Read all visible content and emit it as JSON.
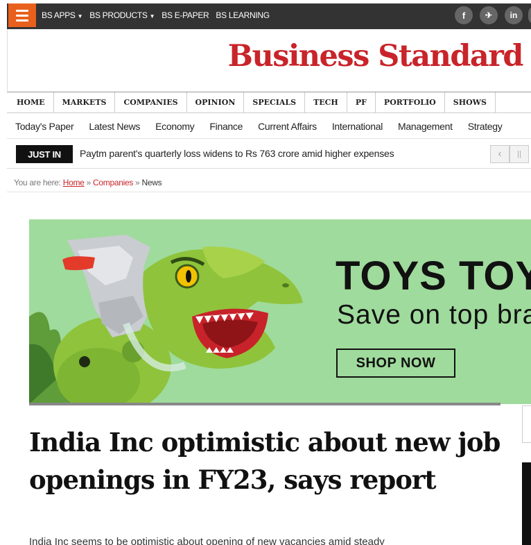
{
  "topbar": {
    "nav": [
      {
        "label": "BS APPS",
        "has_caret": true
      },
      {
        "label": "BS PRODUCTS",
        "has_caret": true
      },
      {
        "label": "BS E-PAPER",
        "has_caret": false
      },
      {
        "label": "BS LEARNING",
        "has_caret": false
      }
    ],
    "social_icons": [
      "facebook-icon",
      "telegram-icon",
      "linkedin-icon"
    ],
    "social_glyphs": {
      "facebook": "f",
      "telegram": "✈",
      "linkedin": "in"
    }
  },
  "masthead": {
    "logo": "Business Standard",
    "logo_color": "#c8242a"
  },
  "main_nav": [
    "HOME",
    "MARKETS",
    "COMPANIES",
    "OPINION",
    "SPECIALS",
    "TECH",
    "PF",
    "PORTFOLIO",
    "SHOWS"
  ],
  "sub_nav": [
    "Today's Paper",
    "Latest News",
    "Economy",
    "Finance",
    "Current Affairs",
    "International",
    "Management",
    "Strategy"
  ],
  "ticker": {
    "label": "JUST IN",
    "headline": "Paytm parent's quarterly loss widens to Rs 763 crore amid higher expenses",
    "prev_glyph": "‹",
    "pause_glyph": "||"
  },
  "breadcrumb": {
    "prefix": "You are here: ",
    "home": "Home",
    "sep1": " » ",
    "section": "Companies",
    "sep2": " » ",
    "current": "News"
  },
  "ad": {
    "title": "TOYS TOYS",
    "subtitle": "Save on top brands",
    "cta": "SHOP NOW",
    "background": "#9fdb9c"
  },
  "article": {
    "title": "India Inc optimistic about new job openings in FY23, says report",
    "summary": "India Inc seems to be optimistic about opening of new vacancies amid steady"
  },
  "colors": {
    "accent": "#e8601c",
    "brand": "#c8242a",
    "topbar": "#333333"
  }
}
